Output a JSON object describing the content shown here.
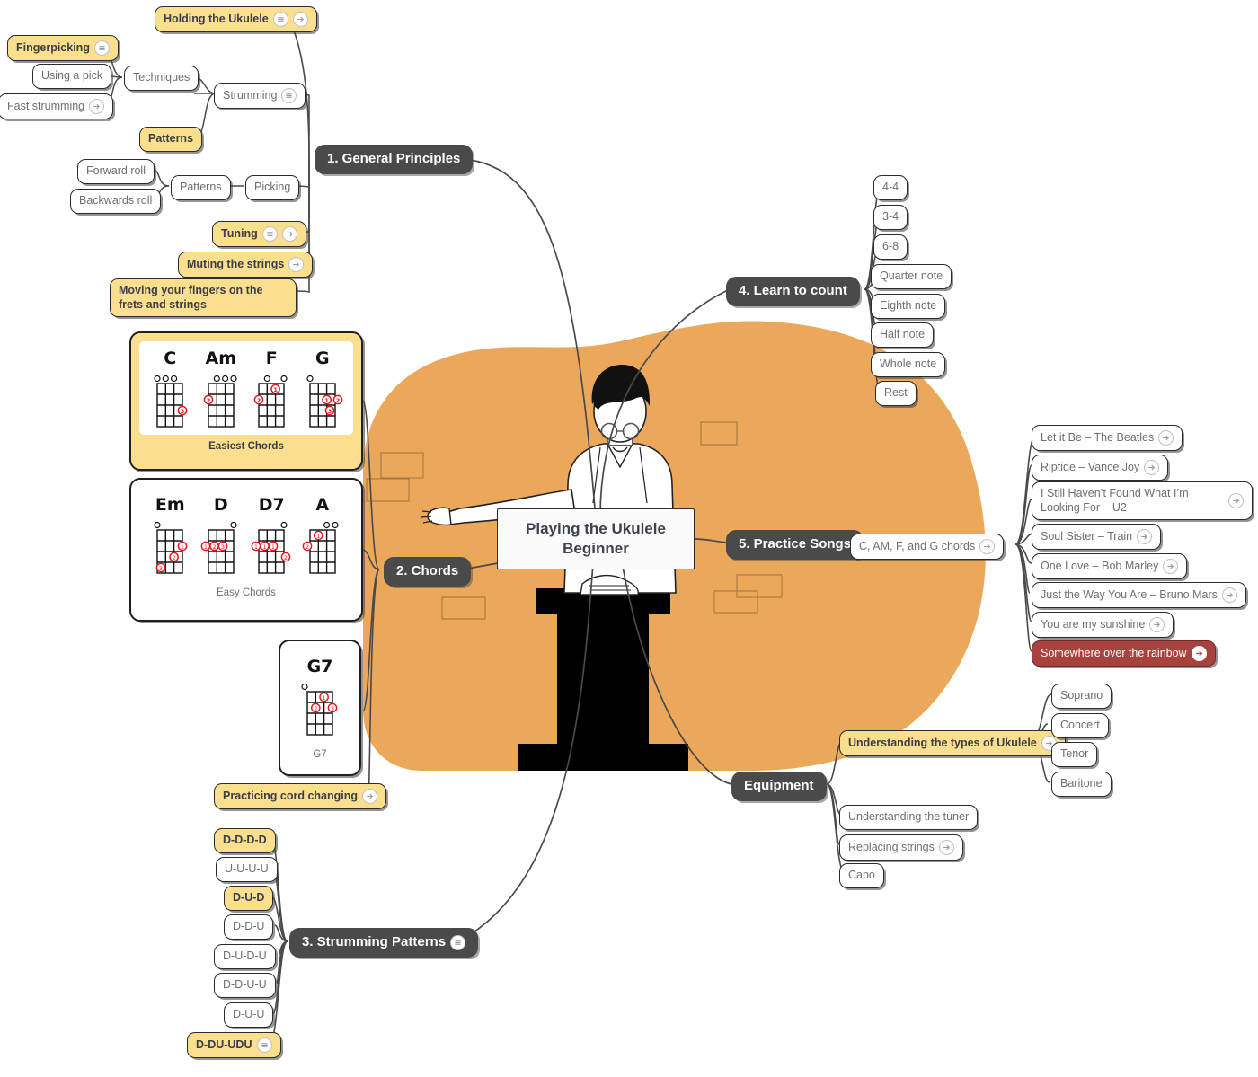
{
  "title": "Playing the Ukulele Beginner",
  "colors": {
    "blob": "#eca85a",
    "yellow": "#fadf8e",
    "main_gray": "#4a4a4a",
    "red": "#a8423f",
    "node_text": "#6f6f6f",
    "dot_red": "#e8191b"
  },
  "center": {
    "label": "Playing the Ukulele\nBeginner"
  },
  "branches": {
    "general_principles": {
      "label": "1. General Principles"
    },
    "chords": {
      "label": "2. Chords"
    },
    "strumming": {
      "label": "3. Strumming Patterns",
      "icons": [
        "list-icon"
      ]
    },
    "learn_to_count": {
      "label": "4. Learn to count"
    },
    "practice_songs": {
      "label": "5. Practice Songs"
    },
    "equipment": {
      "label": "Equipment"
    }
  },
  "general_principles_nodes": [
    {
      "label": "Holding the Ukulele",
      "style": "yellow",
      "icons": [
        "list-icon",
        "arrow-icon"
      ]
    },
    {
      "label": "Fingerpicking",
      "style": "yellow",
      "icons": [
        "list-icon"
      ]
    },
    {
      "label": "Using a pick",
      "style": "plain",
      "icons": []
    },
    {
      "label": "Techniques",
      "style": "plain",
      "icons": []
    },
    {
      "label": "Fast strumming",
      "style": "plain",
      "icons": [
        "arrow-icon"
      ]
    },
    {
      "label": "Strumming",
      "style": "plain",
      "icons": [
        "list-icon"
      ]
    },
    {
      "label": "Patterns",
      "style": "yellow",
      "icons": []
    },
    {
      "label": "Forward roll",
      "style": "plain",
      "icons": []
    },
    {
      "label": "Patterns",
      "style": "plain",
      "icons": []
    },
    {
      "label": "Picking",
      "style": "plain",
      "icons": []
    },
    {
      "label": "Backwards roll",
      "style": "plain",
      "icons": []
    },
    {
      "label": "Tuning",
      "style": "yellow",
      "icons": [
        "list-icon",
        "arrow-icon"
      ]
    },
    {
      "label": "Muting the strings",
      "style": "yellow",
      "icons": [
        "arrow-icon"
      ]
    },
    {
      "label": "Moving your fingers on the frets and strings",
      "style": "yellow",
      "icons": []
    }
  ],
  "chords_cards": [
    {
      "caption": "Easiest Chords",
      "style": "yellow",
      "chords": [
        {
          "name": "C",
          "open": [
            1,
            1,
            1,
            0
          ],
          "dots": [
            {
              "string": 4,
              "fret": 3,
              "finger": "3"
            }
          ]
        },
        {
          "name": "Am",
          "open": [
            0,
            1,
            1,
            1
          ],
          "dots": [
            {
              "string": 1,
              "fret": 2,
              "finger": "2"
            }
          ]
        },
        {
          "name": "F",
          "open": [
            0,
            1,
            0,
            1
          ],
          "dots": [
            {
              "string": 1,
              "fret": 2,
              "finger": "2"
            },
            {
              "string": 3,
              "fret": 1,
              "finger": "1"
            }
          ]
        },
        {
          "name": "G",
          "open": [
            0,
            1,
            1,
            1
          ],
          "dots": [
            {
              "string": 3,
              "fret": 2,
              "finger": "1"
            },
            {
              "string": 4,
              "fret": 2,
              "finger": "2"
            },
            {
              "string": 3,
              "fret": 3,
              "finger": "3"
            }
          ]
        }
      ]
    },
    {
      "caption": "Easy Chords",
      "style": "plain",
      "chords": [
        {
          "name": "Em",
          "open": [
            1,
            0,
            0,
            0
          ],
          "dots": [
            {
              "string": 4,
              "fret": 2,
              "finger": "1"
            },
            {
              "string": 3,
              "fret": 3,
              "finger": "2"
            },
            {
              "string": 2,
              "fret": 4,
              "finger": "3"
            }
          ]
        },
        {
          "name": "D",
          "open": [
            0,
            0,
            0,
            1
          ],
          "dots": [
            {
              "string": 1,
              "fret": 2,
              "finger": "1"
            },
            {
              "string": 2,
              "fret": 2,
              "finger": "2"
            },
            {
              "string": 3,
              "fret": 2,
              "finger": "3"
            }
          ]
        },
        {
          "name": "D7",
          "open": [
            0,
            0,
            0,
            1
          ],
          "dots": [
            {
              "string": 1,
              "fret": 2,
              "finger": "1"
            },
            {
              "string": 2,
              "fret": 2,
              "finger": "1"
            },
            {
              "string": 3,
              "fret": 2,
              "finger": "1"
            },
            {
              "string": 4,
              "fret": 3,
              "finger": "2"
            }
          ]
        },
        {
          "name": "A",
          "open": [
            0,
            0,
            1,
            1
          ],
          "dots": [
            {
              "string": 2,
              "fret": 1,
              "finger": "1"
            },
            {
              "string": 1,
              "fret": 2,
              "finger": "2"
            }
          ]
        }
      ]
    },
    {
      "caption": "G7",
      "style": "plain",
      "chords": [
        {
          "name": "G7",
          "open": [
            1,
            0,
            0,
            0
          ],
          "dots": [
            {
              "string": 3,
              "fret": 1,
              "finger": "1"
            },
            {
              "string": 2,
              "fret": 2,
              "finger": "2"
            },
            {
              "string": 4,
              "fret": 2,
              "finger": "3"
            }
          ]
        }
      ]
    }
  ],
  "chords_extra": [
    {
      "label": "Practicing cord changing",
      "style": "yellow",
      "icons": [
        "arrow-icon"
      ]
    }
  ],
  "strumming_nodes": [
    {
      "label": "D-D-D-D",
      "style": "yellow",
      "icons": []
    },
    {
      "label": "U-U-U-U",
      "style": "plain",
      "icons": []
    },
    {
      "label": "D-U-D",
      "style": "yellow",
      "icons": []
    },
    {
      "label": "D-D-U",
      "style": "plain",
      "icons": []
    },
    {
      "label": "D-U-D-U",
      "style": "plain",
      "icons": []
    },
    {
      "label": "D-D-U-U",
      "style": "plain",
      "icons": []
    },
    {
      "label": "D-U-U",
      "style": "plain",
      "icons": []
    },
    {
      "label": "D-DU-UDU",
      "style": "yellow",
      "icons": [
        "list-icon"
      ]
    }
  ],
  "learn_to_count_nodes": [
    {
      "label": "4-4",
      "style": "plain",
      "icons": []
    },
    {
      "label": "3-4",
      "style": "plain",
      "icons": []
    },
    {
      "label": "6-8",
      "style": "plain",
      "icons": []
    },
    {
      "label": "Quarter note",
      "style": "plain",
      "icons": []
    },
    {
      "label": "Eighth note",
      "style": "plain",
      "icons": []
    },
    {
      "label": "Half note",
      "style": "plain",
      "icons": []
    },
    {
      "label": "Whole note",
      "style": "plain",
      "icons": []
    },
    {
      "label": "Rest",
      "style": "plain",
      "icons": []
    }
  ],
  "practice_songs_group": {
    "label": "C, AM, F, and G chords",
    "style": "plain",
    "icons": [
      "arrow-icon"
    ]
  },
  "practice_songs_nodes": [
    {
      "label": "Let it Be – The Beatles",
      "style": "plain",
      "icons": [
        "arrow-icon"
      ]
    },
    {
      "label": "Riptide – Vance Joy",
      "style": "plain",
      "icons": [
        "arrow-icon"
      ]
    },
    {
      "label": "I Still Haven’t Found What I’m Looking For – U2",
      "style": "plain",
      "icons": [
        "arrow-icon"
      ]
    },
    {
      "label": "Soul Sister – Train",
      "style": "plain",
      "icons": [
        "arrow-icon"
      ]
    },
    {
      "label": "One Love – Bob Marley",
      "style": "plain",
      "icons": [
        "arrow-icon"
      ]
    },
    {
      "label": "Just the Way You Are – Bruno Mars",
      "style": "plain",
      "icons": [
        "arrow-icon"
      ]
    },
    {
      "label": "You are my sunshine",
      "style": "plain",
      "icons": [
        "arrow-icon"
      ]
    },
    {
      "label": "Somewhere over the rainbow",
      "style": "red",
      "icons": [
        "arrow-icon"
      ]
    }
  ],
  "equipment_nodes": [
    {
      "label": "Understanding the types of Ukulele",
      "style": "yellow",
      "icons": [
        "arrow-icon"
      ]
    },
    {
      "label": "Understanding the tuner",
      "style": "plain",
      "icons": []
    },
    {
      "label": "Replacing strings",
      "style": "plain",
      "icons": [
        "arrow-icon"
      ]
    },
    {
      "label": "Capo",
      "style": "plain",
      "icons": []
    }
  ],
  "ukulele_types": [
    {
      "label": "Soprano",
      "style": "plain",
      "icons": []
    },
    {
      "label": "Concert",
      "style": "plain",
      "icons": []
    },
    {
      "label": "Tenor",
      "style": "plain",
      "icons": []
    },
    {
      "label": "Baritone",
      "style": "plain",
      "icons": []
    }
  ]
}
